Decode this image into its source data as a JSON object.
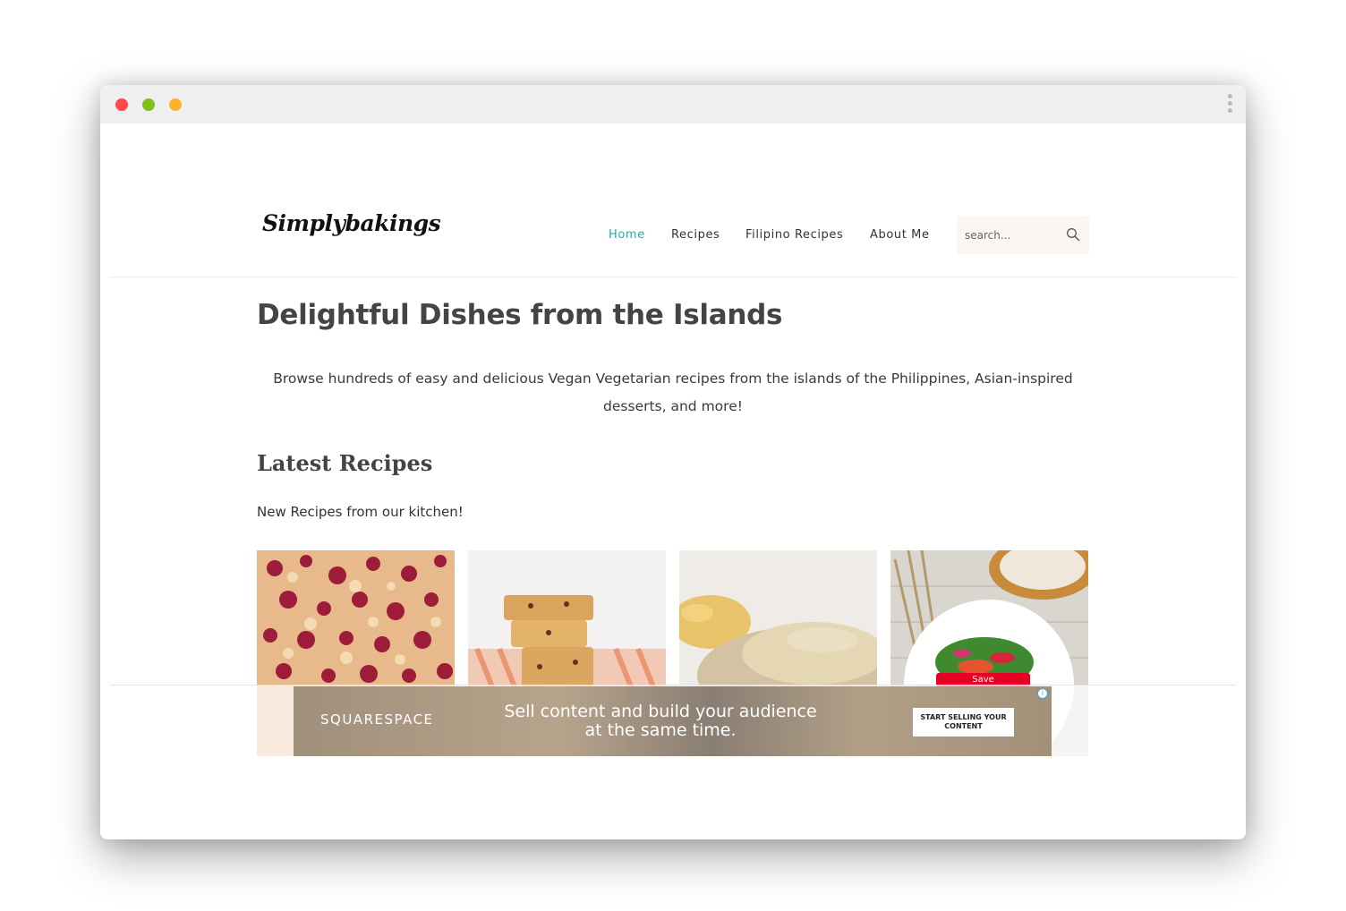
{
  "site": {
    "logo": "Simplybakings"
  },
  "nav": {
    "items": [
      {
        "label": "Home",
        "active": true
      },
      {
        "label": "Recipes"
      },
      {
        "label": "Filipino Recipes"
      },
      {
        "label": "About Me"
      }
    ],
    "search_placeholder": "search..."
  },
  "main": {
    "heading": "Delightful Dishes from the Islands",
    "intro": "Browse hundreds of easy and delicious Vegan Vegetarian recipes from the islands of the Philippines, Asian-inspired desserts, and more!",
    "latest_heading": "Latest Recipes",
    "latest_subtitle": "New Recipes from our kitchen!"
  },
  "recipe_cards": [
    {
      "image": "berry-crumble-bars-photo"
    },
    {
      "image": "blondie-bars-stack-photo"
    },
    {
      "image": "hummus-dip-photo"
    },
    {
      "image": "salad-bowl-photo"
    }
  ],
  "pin_save_label": "Save",
  "ad": {
    "brand": "SQUARESPACE",
    "headline_line1": "Sell content and build your audience",
    "headline_line2": "at the same time.",
    "cta": "START SELLING YOUR CONTENT",
    "info_icon": "i"
  },
  "colors": {
    "accent": "#1fb0a6",
    "heading": "#444444",
    "search_bg": "#fbf6f1"
  }
}
